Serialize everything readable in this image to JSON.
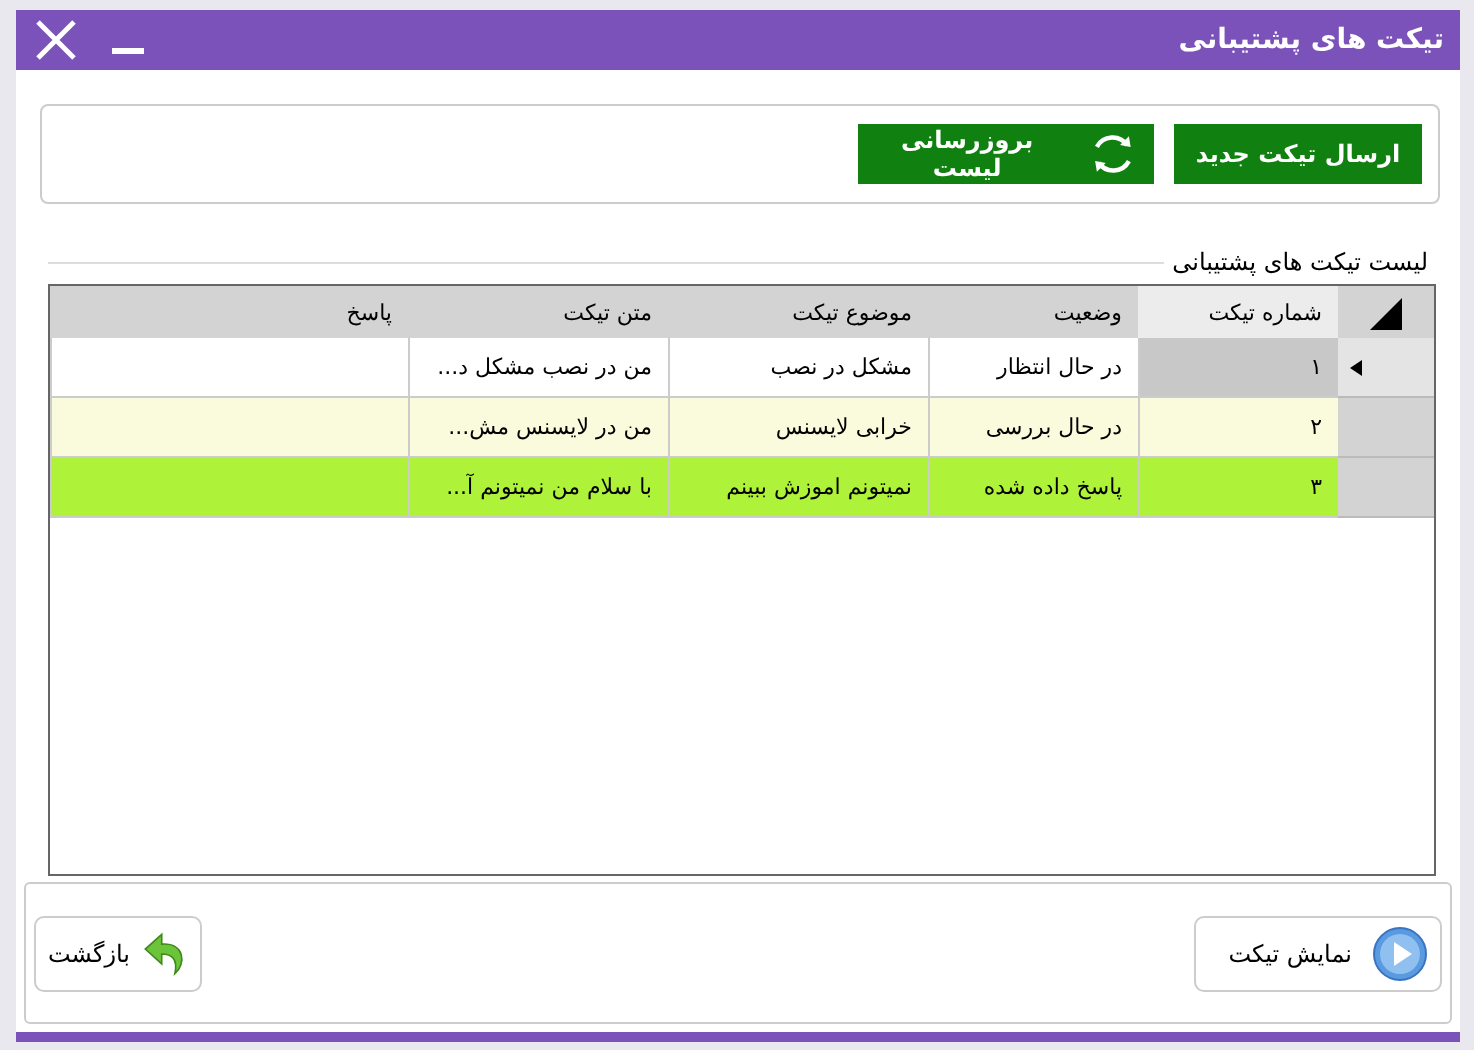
{
  "window": {
    "title": "تیکت های پشتیبانی"
  },
  "toolbar": {
    "buttons": [
      {
        "label": "ارسال تیکت جدید",
        "kind": "plain"
      },
      {
        "label": "بروزرسانی لیست",
        "kind": "refresh"
      }
    ]
  },
  "group": {
    "title": "لیست تیکت های پشتیبانی"
  },
  "table": {
    "columns": [
      "شماره تیکت",
      "وضعیت",
      "موضوع تیکت",
      "متن تیکت",
      "پاسخ"
    ],
    "rows": [
      {
        "cells": [
          "۱",
          "در حال انتظار",
          "مشکل در نصب",
          "من در نصب مشکل د...",
          ""
        ],
        "selected": true,
        "color": "#ffffff"
      },
      {
        "cells": [
          "۲",
          "در حال بررسی",
          "خرابی لایسنس",
          "من در لایسنس مش...",
          ""
        ],
        "selected": false,
        "color": "#fafadc"
      },
      {
        "cells": [
          "۳",
          "پاسخ داده شده",
          "نمیتونم اموزش ببینم",
          "با سلام من نمیتونم آ...",
          ""
        ],
        "selected": false,
        "color": "#aef23a"
      }
    ]
  },
  "footer": {
    "buttons": [
      {
        "label": "نمایش تیکت",
        "kind": "play"
      },
      {
        "label": "بازگشت",
        "kind": "back"
      }
    ]
  }
}
